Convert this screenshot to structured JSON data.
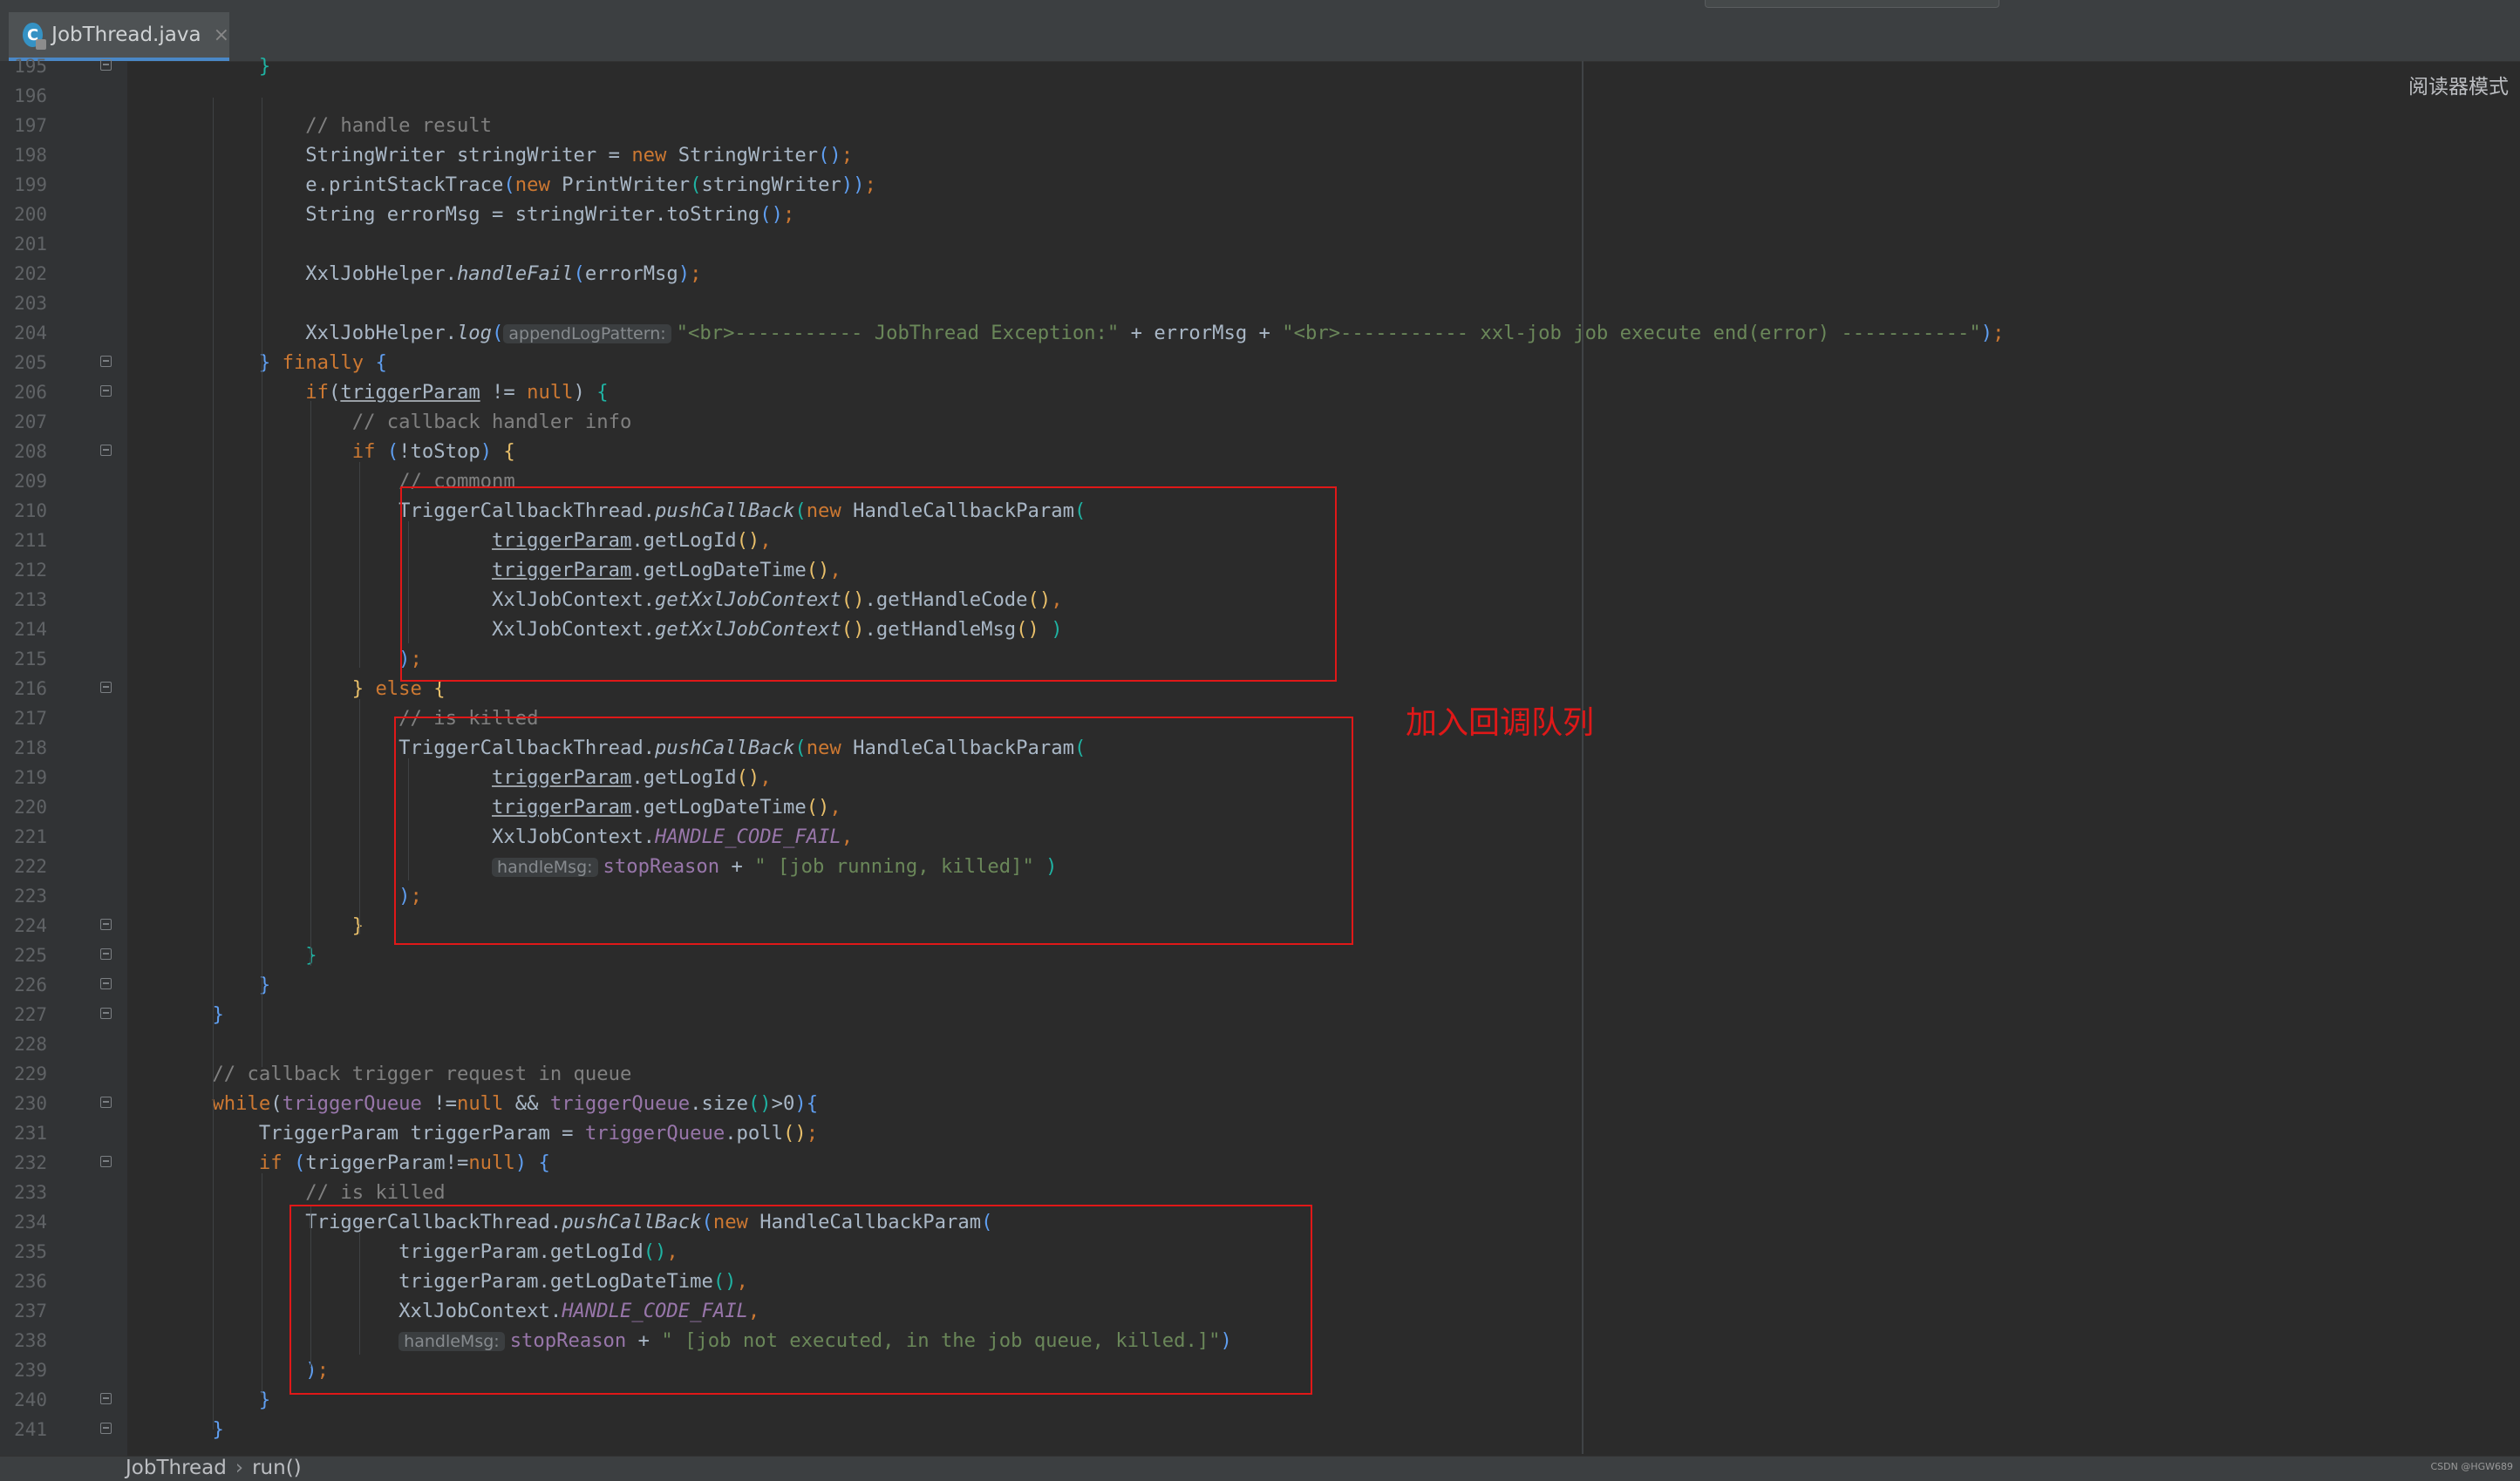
{
  "tab": {
    "label": "JobThread.java",
    "close": "×",
    "icon_letter": "C"
  },
  "reader_mode": "阅读器模式",
  "annotation": "加入回调队列",
  "breadcrumb": {
    "class_name": "JobThread",
    "sep": "›",
    "method": "run()"
  },
  "watermark": "CSDN @HGW689",
  "colors": {
    "annotation_red": "#e01818",
    "keyword": "#cc7832",
    "comment": "#808080",
    "string": "#6a8759",
    "constant": "#9876aa"
  },
  "lines": [
    {
      "n": "195",
      "segs": [
        {
          "t": "        "
        },
        {
          "t": "}",
          "c": "p3"
        }
      ]
    },
    {
      "n": "196",
      "segs": []
    },
    {
      "n": "197",
      "segs": [
        {
          "t": "            // handle result",
          "c": "cm"
        }
      ]
    },
    {
      "n": "198",
      "segs": [
        {
          "t": "            StringWriter stringWriter = "
        },
        {
          "t": "new",
          "c": "kw"
        },
        {
          "t": " StringWriter"
        },
        {
          "t": "()",
          "c": "p2"
        },
        {
          "t": ";",
          "c": "kw"
        }
      ]
    },
    {
      "n": "199",
      "segs": [
        {
          "t": "            e.printStackTrace"
        },
        {
          "t": "(",
          "c": "p2"
        },
        {
          "t": "new",
          "c": "kw"
        },
        {
          "t": " PrintWriter"
        },
        {
          "t": "(",
          "c": "p3"
        },
        {
          "t": "stringWriter"
        },
        {
          "t": "))",
          "c": "p2"
        },
        {
          "t": ";",
          "c": "kw"
        }
      ]
    },
    {
      "n": "200",
      "segs": [
        {
          "t": "            String errorMsg = stringWriter.toString"
        },
        {
          "t": "()",
          "c": "p2"
        },
        {
          "t": ";",
          "c": "kw"
        }
      ]
    },
    {
      "n": "201",
      "segs": []
    },
    {
      "n": "202",
      "segs": [
        {
          "t": "            XxlJobHelper."
        },
        {
          "t": "handleFail",
          "c": "it"
        },
        {
          "t": "(",
          "c": "p2"
        },
        {
          "t": "errorMsg"
        },
        {
          "t": ")",
          "c": "p2"
        },
        {
          "t": ";",
          "c": "kw"
        }
      ]
    },
    {
      "n": "203",
      "segs": []
    },
    {
      "n": "204",
      "segs": [
        {
          "t": "            XxlJobHelper."
        },
        {
          "t": "log",
          "c": "it"
        },
        {
          "t": "(",
          "c": "p2"
        },
        {
          "t": "appendLogPattern:",
          "c": "hint"
        },
        {
          "t": "\"<br>----------- JobThread Exception:\"",
          "c": "st"
        },
        {
          "t": " + errorMsg + "
        },
        {
          "t": "\"<br>----------- xxl-job job execute end(error) -----------\"",
          "c": "st"
        },
        {
          "t": ")",
          "c": "p2"
        },
        {
          "t": ";",
          "c": "kw"
        }
      ]
    },
    {
      "n": "205",
      "segs": [
        {
          "t": "        "
        },
        {
          "t": "}",
          "c": "p2"
        },
        {
          "t": " "
        },
        {
          "t": "finally",
          "c": "kw"
        },
        {
          "t": " "
        },
        {
          "t": "{",
          "c": "p2"
        }
      ]
    },
    {
      "n": "206",
      "segs": [
        {
          "t": "            "
        },
        {
          "t": "if",
          "c": "kw"
        },
        {
          "t": "("
        },
        {
          "t": "triggerParam",
          "c": "ul"
        },
        {
          "t": " != "
        },
        {
          "t": "null",
          "c": "kw"
        },
        {
          "t": ") "
        },
        {
          "t": "{",
          "c": "p3"
        }
      ]
    },
    {
      "n": "207",
      "segs": [
        {
          "t": "                // callback handler info",
          "c": "cm"
        }
      ]
    },
    {
      "n": "208",
      "segs": [
        {
          "t": "                "
        },
        {
          "t": "if",
          "c": "kw"
        },
        {
          "t": " "
        },
        {
          "t": "(",
          "c": "p2"
        },
        {
          "t": "!toStop"
        },
        {
          "t": ")",
          "c": "p2"
        },
        {
          "t": " "
        },
        {
          "t": "{",
          "c": "p1"
        }
      ]
    },
    {
      "n": "209",
      "segs": [
        {
          "t": "                    // commonm",
          "c": "cm"
        }
      ]
    },
    {
      "n": "210",
      "segs": [
        {
          "t": "                    TriggerCallbackThread."
        },
        {
          "t": "pushCallBack",
          "c": "it"
        },
        {
          "t": "(",
          "c": "p3"
        },
        {
          "t": "new",
          "c": "kw"
        },
        {
          "t": " HandleCallbackParam"
        },
        {
          "t": "(",
          "c": "p3"
        }
      ]
    },
    {
      "n": "211",
      "segs": [
        {
          "t": "                            "
        },
        {
          "t": "triggerParam",
          "c": "ul"
        },
        {
          "t": ".getLogId"
        },
        {
          "t": "()",
          "c": "p1"
        },
        {
          "t": ",",
          "c": "kw"
        }
      ]
    },
    {
      "n": "212",
      "segs": [
        {
          "t": "                            "
        },
        {
          "t": "triggerParam",
          "c": "ul"
        },
        {
          "t": ".getLogDateTime"
        },
        {
          "t": "()",
          "c": "p1"
        },
        {
          "t": ",",
          "c": "kw"
        }
      ]
    },
    {
      "n": "213",
      "segs": [
        {
          "t": "                            XxlJobContext."
        },
        {
          "t": "getXxlJobContext",
          "c": "it"
        },
        {
          "t": "()",
          "c": "p1"
        },
        {
          "t": ".getHandleCode"
        },
        {
          "t": "()",
          "c": "p1"
        },
        {
          "t": ",",
          "c": "kw"
        }
      ]
    },
    {
      "n": "214",
      "segs": [
        {
          "t": "                            XxlJobContext."
        },
        {
          "t": "getXxlJobContext",
          "c": "it"
        },
        {
          "t": "()",
          "c": "p1"
        },
        {
          "t": ".getHandleMsg"
        },
        {
          "t": "()",
          "c": "p1"
        },
        {
          "t": " "
        },
        {
          "t": ")",
          "c": "p3"
        }
      ]
    },
    {
      "n": "215",
      "segs": [
        {
          "t": "                    "
        },
        {
          "t": ")",
          "c": "p2"
        },
        {
          "t": ";",
          "c": "kw"
        }
      ]
    },
    {
      "n": "216",
      "segs": [
        {
          "t": "                "
        },
        {
          "t": "}",
          "c": "p1"
        },
        {
          "t": " "
        },
        {
          "t": "else",
          "c": "kw"
        },
        {
          "t": " "
        },
        {
          "t": "{",
          "c": "p1"
        }
      ]
    },
    {
      "n": "217",
      "segs": [
        {
          "t": "                    // is killed",
          "c": "cm"
        }
      ]
    },
    {
      "n": "218",
      "segs": [
        {
          "t": "                    TriggerCallbackThread."
        },
        {
          "t": "pushCallBack",
          "c": "it"
        },
        {
          "t": "(",
          "c": "p3"
        },
        {
          "t": "new",
          "c": "kw"
        },
        {
          "t": " HandleCallbackParam"
        },
        {
          "t": "(",
          "c": "p3"
        }
      ]
    },
    {
      "n": "219",
      "segs": [
        {
          "t": "                            "
        },
        {
          "t": "triggerParam",
          "c": "ul"
        },
        {
          "t": ".getLogId"
        },
        {
          "t": "()",
          "c": "p1"
        },
        {
          "t": ",",
          "c": "kw"
        }
      ]
    },
    {
      "n": "220",
      "segs": [
        {
          "t": "                            "
        },
        {
          "t": "triggerParam",
          "c": "ul"
        },
        {
          "t": ".getLogDateTime"
        },
        {
          "t": "()",
          "c": "p1"
        },
        {
          "t": ",",
          "c": "kw"
        }
      ]
    },
    {
      "n": "221",
      "segs": [
        {
          "t": "                            XxlJobContext."
        },
        {
          "t": "HANDLE_CODE_FAIL",
          "c": "cst"
        },
        {
          "t": ",",
          "c": "kw"
        }
      ]
    },
    {
      "n": "222",
      "segs": [
        {
          "t": "                            "
        },
        {
          "t": "handleMsg:",
          "c": "hint"
        },
        {
          "t": "stopReason",
          "c": "fld"
        },
        {
          "t": " + "
        },
        {
          "t": "\" [job running, killed]\"",
          "c": "st"
        },
        {
          "t": " "
        },
        {
          "t": ")",
          "c": "p3"
        }
      ]
    },
    {
      "n": "223",
      "segs": [
        {
          "t": "                    "
        },
        {
          "t": ")",
          "c": "p2"
        },
        {
          "t": ";",
          "c": "kw"
        }
      ]
    },
    {
      "n": "224",
      "segs": [
        {
          "t": "                "
        },
        {
          "t": "}",
          "c": "p1"
        }
      ]
    },
    {
      "n": "225",
      "segs": [
        {
          "t": "            "
        },
        {
          "t": "}",
          "c": "p3"
        }
      ]
    },
    {
      "n": "226",
      "segs": [
        {
          "t": "        "
        },
        {
          "t": "}",
          "c": "p2"
        }
      ]
    },
    {
      "n": "227",
      "segs": [
        {
          "t": "    "
        },
        {
          "t": "}",
          "c": "p2"
        }
      ]
    },
    {
      "n": "228",
      "segs": []
    },
    {
      "n": "229",
      "segs": [
        {
          "t": "    // callback trigger request in queue",
          "c": "cm"
        }
      ]
    },
    {
      "n": "230",
      "segs": [
        {
          "t": "    "
        },
        {
          "t": "while",
          "c": "kw"
        },
        {
          "t": "("
        },
        {
          "t": "triggerQueue",
          "c": "fld"
        },
        {
          "t": " !="
        },
        {
          "t": "null",
          "c": "kw"
        },
        {
          "t": " && "
        },
        {
          "t": "triggerQueue",
          "c": "fld"
        },
        {
          "t": ".size"
        },
        {
          "t": "()",
          "c": "p3"
        },
        {
          "t": ">0"
        },
        {
          "t": ")",
          "c": "p2"
        },
        {
          "t": "{",
          "c": "p2"
        }
      ]
    },
    {
      "n": "231",
      "segs": [
        {
          "t": "        TriggerParam triggerParam = "
        },
        {
          "t": "triggerQueue",
          "c": "fld"
        },
        {
          "t": ".poll"
        },
        {
          "t": "()",
          "c": "p1"
        },
        {
          "t": ";",
          "c": "kw"
        }
      ]
    },
    {
      "n": "232",
      "segs": [
        {
          "t": "        "
        },
        {
          "t": "if",
          "c": "kw"
        },
        {
          "t": " "
        },
        {
          "t": "(",
          "c": "p2"
        },
        {
          "t": "triggerParam!="
        },
        {
          "t": "null",
          "c": "kw"
        },
        {
          "t": ")",
          "c": "p2"
        },
        {
          "t": " "
        },
        {
          "t": "{",
          "c": "p2"
        }
      ]
    },
    {
      "n": "233",
      "segs": [
        {
          "t": "            // is killed",
          "c": "cm"
        }
      ]
    },
    {
      "n": "234",
      "segs": [
        {
          "t": "            TriggerCallbackThread."
        },
        {
          "t": "pushCallBack",
          "c": "it"
        },
        {
          "t": "(",
          "c": "p2"
        },
        {
          "t": "new",
          "c": "kw"
        },
        {
          "t": " HandleCallbackParam"
        },
        {
          "t": "(",
          "c": "p2"
        }
      ]
    },
    {
      "n": "235",
      "segs": [
        {
          "t": "                    triggerParam.getLogId"
        },
        {
          "t": "()",
          "c": "p3"
        },
        {
          "t": ",",
          "c": "kw"
        }
      ]
    },
    {
      "n": "236",
      "segs": [
        {
          "t": "                    triggerParam.getLogDateTime"
        },
        {
          "t": "()",
          "c": "p3"
        },
        {
          "t": ",",
          "c": "kw"
        }
      ]
    },
    {
      "n": "237",
      "segs": [
        {
          "t": "                    XxlJobContext."
        },
        {
          "t": "HANDLE_CODE_FAIL",
          "c": "cst"
        },
        {
          "t": ",",
          "c": "kw"
        }
      ]
    },
    {
      "n": "238",
      "segs": [
        {
          "t": "                    "
        },
        {
          "t": "handleMsg:",
          "c": "hint"
        },
        {
          "t": "stopReason",
          "c": "fld"
        },
        {
          "t": " + "
        },
        {
          "t": "\" [job not executed, in the job queue, killed.]\"",
          "c": "st"
        },
        {
          "t": ")",
          "c": "p2"
        }
      ]
    },
    {
      "n": "239",
      "segs": [
        {
          "t": "            "
        },
        {
          "t": ")",
          "c": "p2"
        },
        {
          "t": ";",
          "c": "kw"
        }
      ]
    },
    {
      "n": "240",
      "segs": [
        {
          "t": "        "
        },
        {
          "t": "}",
          "c": "p2"
        }
      ]
    },
    {
      "n": "241",
      "segs": [
        {
          "t": "    "
        },
        {
          "t": "}",
          "c": "p2"
        }
      ]
    }
  ]
}
